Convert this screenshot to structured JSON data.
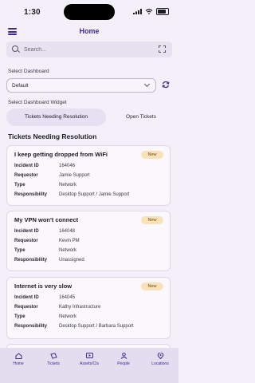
{
  "status_bar": {
    "time": "1:30"
  },
  "header": {
    "title": "Home"
  },
  "search": {
    "placeholder": "Search..."
  },
  "dashboard": {
    "select_label": "Select Dashboard",
    "selected": "Default",
    "widget_label": "Select Dashboard Widget",
    "tabs": [
      {
        "label": "Tickets Needing Resolution",
        "active": true
      },
      {
        "label": "Open Tickets",
        "active": false
      }
    ]
  },
  "section": {
    "heading": "Tickets Needing Resolution"
  },
  "field_labels": {
    "incident_id": "Incident ID",
    "requestor": "Requestor",
    "type": "Type",
    "responsibility": "Responsibility"
  },
  "tickets": [
    {
      "title": "I keep getting dropped from WiFi",
      "badge": "New",
      "incident_id": "164046",
      "requestor": "Jamie Support",
      "type": "Network",
      "responsibility": "Desktop Support / Jamie Support"
    },
    {
      "title": "My VPN won't connect",
      "badge": "New",
      "incident_id": "164048",
      "requestor": "Kevin PM",
      "type": "Network",
      "responsibility": "Unassigned"
    },
    {
      "title": "Internet is very slow",
      "badge": "New",
      "incident_id": "164045",
      "requestor": "Kathy Infrastructure",
      "type": "Network",
      "responsibility": "Desktop Support / Barbara Support"
    }
  ],
  "bottom_nav": [
    {
      "label": "Home",
      "icon": "home-icon"
    },
    {
      "label": "Tickets",
      "icon": "ticket-icon"
    },
    {
      "label": "Assets/CIs",
      "icon": "asset-icon"
    },
    {
      "label": "People",
      "icon": "person-icon"
    },
    {
      "label": "Locations",
      "icon": "location-icon"
    }
  ],
  "colors": {
    "accent": "#3d2c8d",
    "badge_bg": "#f9e2b7",
    "background": "#f3f0f9"
  }
}
